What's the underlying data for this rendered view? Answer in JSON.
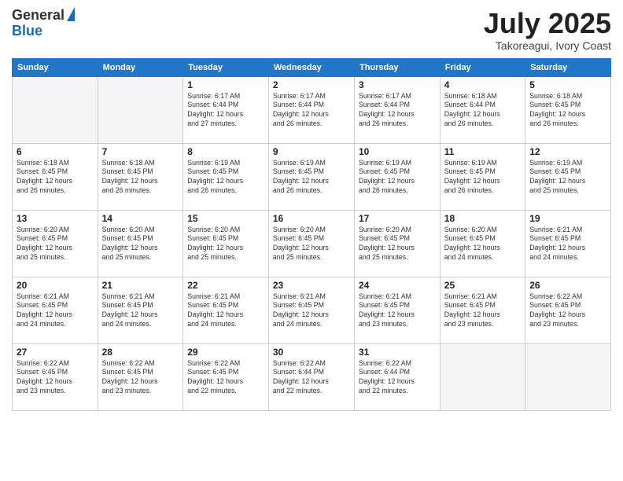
{
  "header": {
    "logo_line1": "General",
    "logo_line2": "Blue",
    "month_title": "July 2025",
    "location": "Takoreagui, Ivory Coast"
  },
  "days_of_week": [
    "Sunday",
    "Monday",
    "Tuesday",
    "Wednesday",
    "Thursday",
    "Friday",
    "Saturday"
  ],
  "weeks": [
    [
      {
        "day": "",
        "empty": true
      },
      {
        "day": "",
        "empty": true
      },
      {
        "day": "1",
        "sunrise": "6:17 AM",
        "sunset": "6:44 PM",
        "daylight": "12 hours and 27 minutes."
      },
      {
        "day": "2",
        "sunrise": "6:17 AM",
        "sunset": "6:44 PM",
        "daylight": "12 hours and 26 minutes."
      },
      {
        "day": "3",
        "sunrise": "6:17 AM",
        "sunset": "6:44 PM",
        "daylight": "12 hours and 26 minutes."
      },
      {
        "day": "4",
        "sunrise": "6:18 AM",
        "sunset": "6:44 PM",
        "daylight": "12 hours and 26 minutes."
      },
      {
        "day": "5",
        "sunrise": "6:18 AM",
        "sunset": "6:45 PM",
        "daylight": "12 hours and 26 minutes."
      }
    ],
    [
      {
        "day": "6",
        "sunrise": "6:18 AM",
        "sunset": "6:45 PM",
        "daylight": "12 hours and 26 minutes."
      },
      {
        "day": "7",
        "sunrise": "6:18 AM",
        "sunset": "6:45 PM",
        "daylight": "12 hours and 26 minutes."
      },
      {
        "day": "8",
        "sunrise": "6:19 AM",
        "sunset": "6:45 PM",
        "daylight": "12 hours and 26 minutes."
      },
      {
        "day": "9",
        "sunrise": "6:19 AM",
        "sunset": "6:45 PM",
        "daylight": "12 hours and 26 minutes."
      },
      {
        "day": "10",
        "sunrise": "6:19 AM",
        "sunset": "6:45 PM",
        "daylight": "12 hours and 26 minutes."
      },
      {
        "day": "11",
        "sunrise": "6:19 AM",
        "sunset": "6:45 PM",
        "daylight": "12 hours and 26 minutes."
      },
      {
        "day": "12",
        "sunrise": "6:19 AM",
        "sunset": "6:45 PM",
        "daylight": "12 hours and 25 minutes."
      }
    ],
    [
      {
        "day": "13",
        "sunrise": "6:20 AM",
        "sunset": "6:45 PM",
        "daylight": "12 hours and 25 minutes."
      },
      {
        "day": "14",
        "sunrise": "6:20 AM",
        "sunset": "6:45 PM",
        "daylight": "12 hours and 25 minutes."
      },
      {
        "day": "15",
        "sunrise": "6:20 AM",
        "sunset": "6:45 PM",
        "daylight": "12 hours and 25 minutes."
      },
      {
        "day": "16",
        "sunrise": "6:20 AM",
        "sunset": "6:45 PM",
        "daylight": "12 hours and 25 minutes."
      },
      {
        "day": "17",
        "sunrise": "6:20 AM",
        "sunset": "6:45 PM",
        "daylight": "12 hours and 25 minutes."
      },
      {
        "day": "18",
        "sunrise": "6:20 AM",
        "sunset": "6:45 PM",
        "daylight": "12 hours and 24 minutes."
      },
      {
        "day": "19",
        "sunrise": "6:21 AM",
        "sunset": "6:45 PM",
        "daylight": "12 hours and 24 minutes."
      }
    ],
    [
      {
        "day": "20",
        "sunrise": "6:21 AM",
        "sunset": "6:45 PM",
        "daylight": "12 hours and 24 minutes."
      },
      {
        "day": "21",
        "sunrise": "6:21 AM",
        "sunset": "6:45 PM",
        "daylight": "12 hours and 24 minutes."
      },
      {
        "day": "22",
        "sunrise": "6:21 AM",
        "sunset": "6:45 PM",
        "daylight": "12 hours and 24 minutes."
      },
      {
        "day": "23",
        "sunrise": "6:21 AM",
        "sunset": "6:45 PM",
        "daylight": "12 hours and 24 minutes."
      },
      {
        "day": "24",
        "sunrise": "6:21 AM",
        "sunset": "6:45 PM",
        "daylight": "12 hours and 23 minutes."
      },
      {
        "day": "25",
        "sunrise": "6:21 AM",
        "sunset": "6:45 PM",
        "daylight": "12 hours and 23 minutes."
      },
      {
        "day": "26",
        "sunrise": "6:22 AM",
        "sunset": "6:45 PM",
        "daylight": "12 hours and 23 minutes."
      }
    ],
    [
      {
        "day": "27",
        "sunrise": "6:22 AM",
        "sunset": "6:45 PM",
        "daylight": "12 hours and 23 minutes."
      },
      {
        "day": "28",
        "sunrise": "6:22 AM",
        "sunset": "6:45 PM",
        "daylight": "12 hours and 23 minutes."
      },
      {
        "day": "29",
        "sunrise": "6:22 AM",
        "sunset": "6:45 PM",
        "daylight": "12 hours and 22 minutes."
      },
      {
        "day": "30",
        "sunrise": "6:22 AM",
        "sunset": "6:44 PM",
        "daylight": "12 hours and 22 minutes."
      },
      {
        "day": "31",
        "sunrise": "6:22 AM",
        "sunset": "6:44 PM",
        "daylight": "12 hours and 22 minutes."
      },
      {
        "day": "",
        "empty": true
      },
      {
        "day": "",
        "empty": true
      }
    ]
  ],
  "labels": {
    "sunrise": "Sunrise:",
    "sunset": "Sunset:",
    "daylight": "Daylight:"
  }
}
